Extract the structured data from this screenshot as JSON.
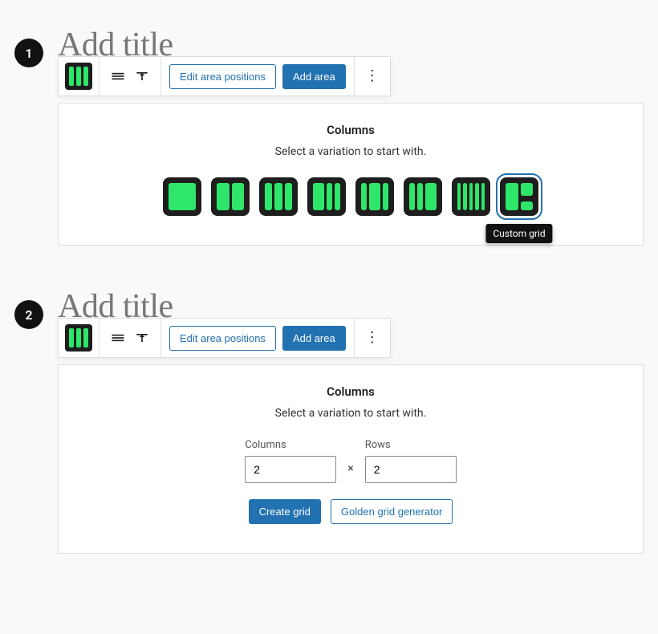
{
  "steps": [
    {
      "number": "1"
    },
    {
      "number": "2"
    }
  ],
  "title_placeholder": "Add title",
  "toolbar": {
    "edit_positions": "Edit area positions",
    "add_area": "Add area"
  },
  "placeholder": {
    "title": "Columns",
    "subtitle": "Select a variation to start with."
  },
  "variations_tooltip": "Custom grid",
  "grid_form": {
    "columns_label": "Columns",
    "rows_label": "Rows",
    "columns_value": "2",
    "rows_value": "2",
    "times": "×",
    "create": "Create grid",
    "golden": "Golden grid generator"
  }
}
